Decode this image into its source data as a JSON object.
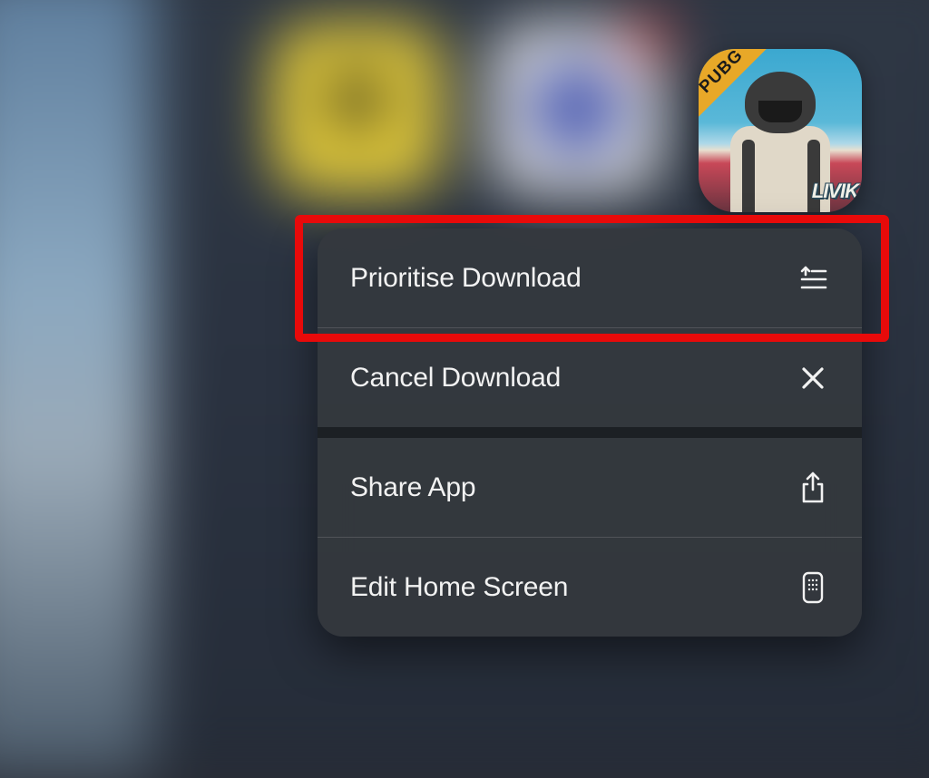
{
  "app_icon": {
    "banner_text": "PUBG",
    "overlay_text": "LIVIK"
  },
  "menu": {
    "items": [
      {
        "label": "Prioritise Download",
        "icon": "prioritise-icon"
      },
      {
        "label": "Cancel Download",
        "icon": "close-icon"
      },
      {
        "label": "Share App",
        "icon": "share-icon"
      },
      {
        "label": "Edit Home Screen",
        "icon": "phone-grid-icon"
      }
    ]
  },
  "annotation": {
    "highlight_target": "prioritise-download"
  }
}
